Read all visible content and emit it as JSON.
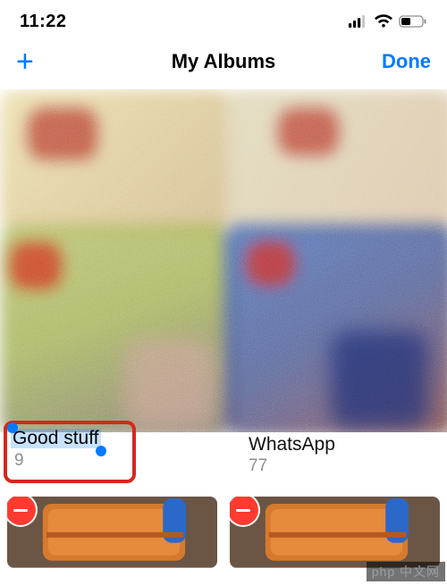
{
  "status": {
    "time": "11:22"
  },
  "nav": {
    "add_label": "+",
    "title": "My Albums",
    "done_label": "Done"
  },
  "albums": [
    {
      "title": "Good stuff",
      "count": "9",
      "editing": true
    },
    {
      "title": "WhatsApp",
      "count": "77",
      "editing": false
    }
  ],
  "icons": {
    "cellular": "cellular-icon",
    "wifi": "wifi-icon",
    "battery": "battery-icon",
    "delete": "minus-circle-icon"
  },
  "colors": {
    "accent": "#007aff",
    "destructive": "#ff3b30",
    "highlight_box": "#d9261b",
    "secondary_text": "#8e8e93"
  },
  "watermark": "php 中文网"
}
